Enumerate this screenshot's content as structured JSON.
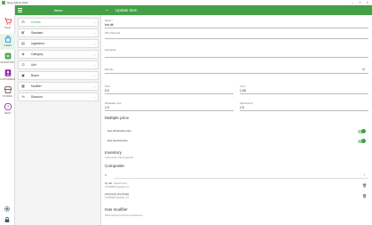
{
  "window": {
    "title": "Nexo Admin POS"
  },
  "rail": {
    "items": [
      {
        "label": "SALE",
        "icon": "cart-icon",
        "color": "#e53935"
      },
      {
        "label": "ITEMS",
        "icon": "shop-icon",
        "color": "#1e88e5",
        "active": true
      },
      {
        "label": "INVENTORY",
        "icon": "inventory-icon",
        "color": "#43a047"
      },
      {
        "label": "CUSTOMERS",
        "icon": "customers-icon",
        "color": "#8e24aa"
      },
      {
        "label": "STORES",
        "icon": "store-icon",
        "color": "#6d4c41"
      },
      {
        "label": "HELP",
        "icon": "help-icon",
        "color": "#8e24aa"
      }
    ],
    "bottom": [
      {
        "icon": "settings-icon"
      },
      {
        "icon": "lock-icon"
      }
    ]
  },
  "list_header": {
    "title": "Items"
  },
  "categories": [
    {
      "label": "Combo",
      "icon": "combo-icon",
      "active": true
    },
    {
      "label": "Standard",
      "icon": "cart-small-icon"
    },
    {
      "label": "Ingredient",
      "icon": "ingredient-icon"
    },
    {
      "label": "Category",
      "icon": "category-icon"
    },
    {
      "label": "Unit",
      "icon": "unit-icon"
    },
    {
      "label": "Brand",
      "icon": "brand-icon"
    },
    {
      "label": "Modifier",
      "icon": "modifier-icon"
    },
    {
      "label": "Discount",
      "icon": "discount-icon"
    }
  ],
  "form_header": {
    "title": "Update Item"
  },
  "form": {
    "name": {
      "label": "Name *",
      "value": "hot dit"
    },
    "sku": {
      "label": "SKU / Barcode",
      "value": ""
    },
    "description": {
      "label": "Description",
      "value": ""
    },
    "barcode": {
      "label": "Barcode",
      "value": ""
    },
    "price": {
      "label": "Price",
      "value": "0.0"
    },
    "cost": {
      "label": "Cost *",
      "value": "1.26"
    },
    "wholesale_price": {
      "label": "Wholesale price",
      "value": "1.0"
    },
    "special_price": {
      "label": "Special price",
      "value": "1.0"
    },
    "multiple_price": {
      "title": "Multiple price",
      "wholesale_label": "Has wholesale price",
      "special_label": "Has special price"
    },
    "inventory": {
      "title": "Inventory",
      "hint": "Track stock / has composite"
    },
    "composite": {
      "title": "Composite",
      "search_placeholder": "Search item...",
      "items": [
        {
          "name": "hy cat",
          "detail": "0.7000000 Quantity 2.0"
        },
        {
          "name": "yang long ong bingg",
          "detail": "0.7000000 Quantity 2.0"
        }
      ]
    },
    "modifier": {
      "title": "Has modifier",
      "hint": "Show options at the time of sale item"
    }
  }
}
